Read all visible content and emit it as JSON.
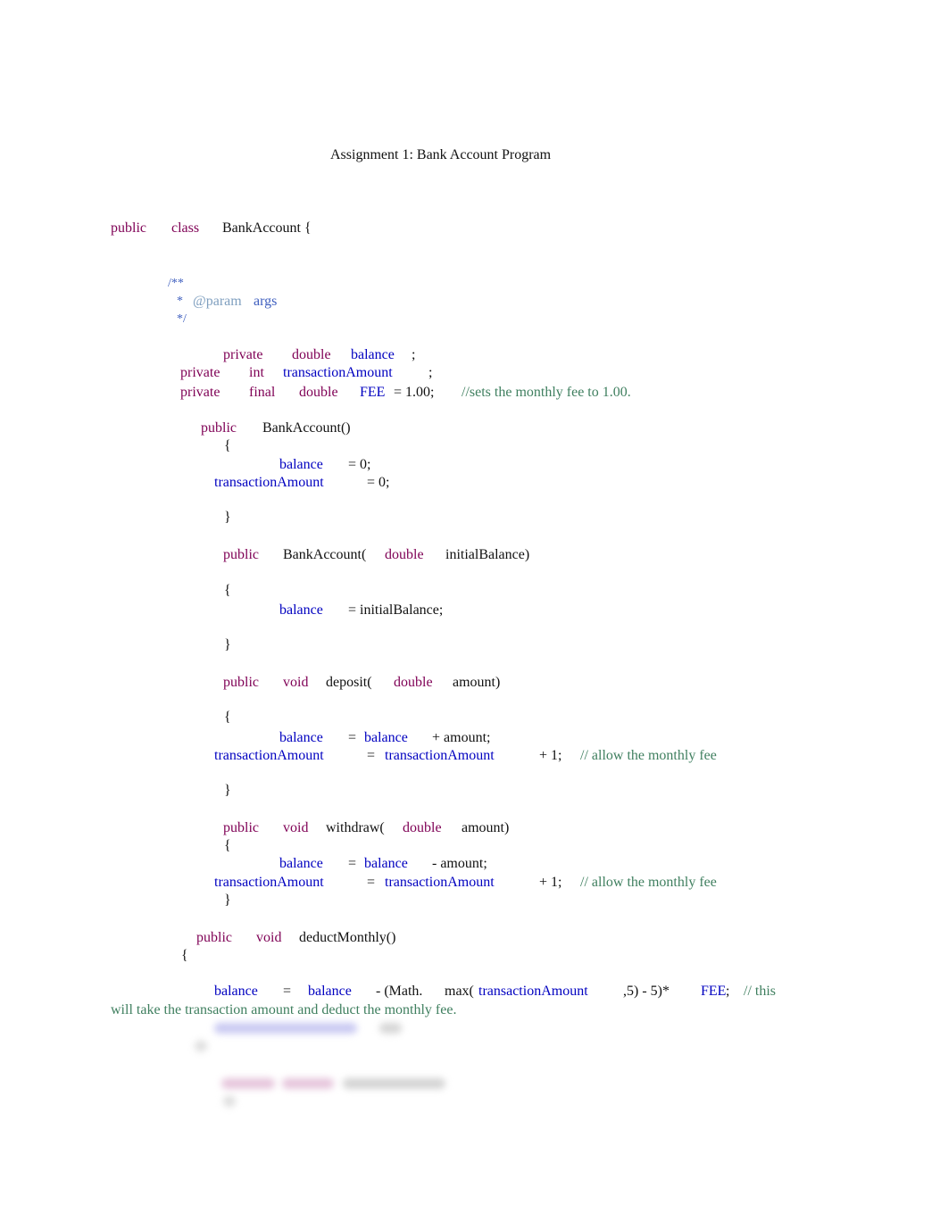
{
  "document": {
    "title": "Assignment 1: Bank Account Program",
    "code": {
      "class_decl": {
        "kw1": "public",
        "kw2": "class",
        "name": "BankAccount {"
      },
      "javadoc": {
        "open": "/**",
        "star": "*",
        "tag": "@param",
        "arg": "args",
        "close": "*/"
      },
      "fields": [
        {
          "mod": "private",
          "type": "double",
          "name": "balance",
          "end": ";"
        },
        {
          "mod": "private",
          "type": "int",
          "name": "transactionAmount",
          "end": ";"
        },
        {
          "mod": "private",
          "mod2": "final",
          "type": "double",
          "name": "FEE",
          "end": "= 1.00;",
          "comment": "//sets the monthly fee to 1.00."
        }
      ],
      "ctor1": {
        "kw": "public",
        "sig": "BankAccount()",
        "open": "{",
        "stmt1_var": "balance",
        "stmt1_rest": "= 0;",
        "stmt2_var": "transactionAmount",
        "stmt2_rest": "= 0;",
        "close": "}"
      },
      "ctor2": {
        "kw": "public",
        "sig": "BankAccount(",
        "ptype": "double",
        "pname": "initialBalance)",
        "open": "{",
        "stmt_var": "balance",
        "stmt_rest": "= initialBalance;",
        "close": "}"
      },
      "deposit": {
        "kw": "public",
        "ret": "void",
        "name": "deposit(",
        "ptype": "double",
        "pname": "amount)",
        "open": "{",
        "s1_var": "balance",
        "s1_eq": "=",
        "s1_var2": "balance",
        "s1_rest": "+ amount;",
        "s2_var": "transactionAmount",
        "s2_eq": "=",
        "s2_var2": "transactionAmount",
        "s2_rest": "+ 1;",
        "s2_comment": "// allow the monthly fee",
        "close": "}"
      },
      "withdraw": {
        "kw": "public",
        "ret": "void",
        "name": "withdraw(",
        "ptype": "double",
        "pname": "amount)",
        "open": "{",
        "s1_var": "balance",
        "s1_eq": "=",
        "s1_var2": "balance",
        "s1_rest": "- amount;",
        "s2_var": "transactionAmount",
        "s2_eq": "=",
        "s2_var2": "transactionAmount",
        "s2_rest": "+ 1;",
        "s2_comment": "// allow the monthly fee",
        "close": "}"
      },
      "deduct": {
        "kw": "public",
        "ret": "void",
        "name": "deductMonthly()",
        "open": "{",
        "s_var": "balance",
        "s_eq": "=",
        "s_var2": "balance",
        "s_math": "- (Math.",
        "s_max": "max(",
        "s_var3": "transactionAmount",
        "s_rest": ",5) - 5)*",
        "s_fee": "FEE",
        "s_semi": ";",
        "s_comment1": "// this",
        "s_comment2": "will take the transaction amount and deduct the monthly fee."
      }
    }
  }
}
